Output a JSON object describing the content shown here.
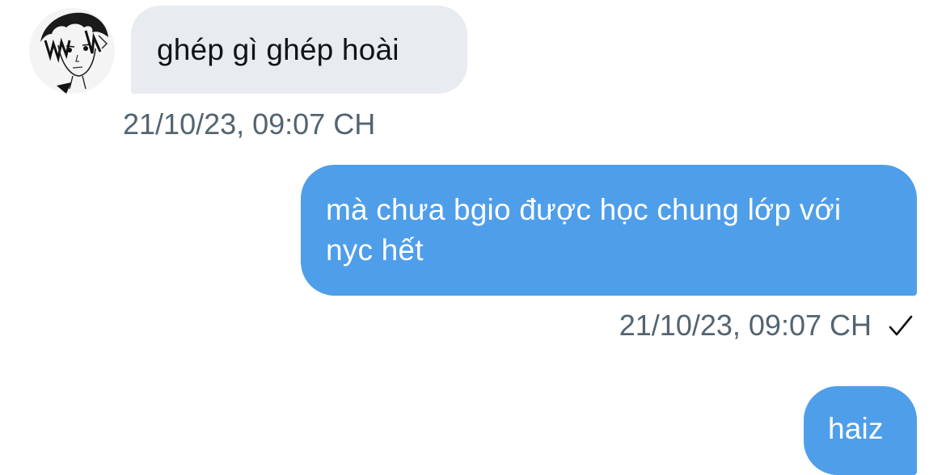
{
  "messages": [
    {
      "direction": "incoming",
      "text": "ghép gì ghép hoài",
      "timestamp": "21/10/23, 09:07 CH"
    },
    {
      "direction": "outgoing",
      "text": "mà chưa bgio được học chung lớp với nyc hết",
      "timestamp": "21/10/23, 09:07 CH",
      "status_icon": "checkmark-icon"
    },
    {
      "direction": "outgoing",
      "text": "haiz"
    }
  ],
  "avatar": {
    "icon": "manga-portrait-avatar"
  },
  "colors": {
    "incoming_bubble": "#e8ecf0",
    "outgoing_bubble": "#4f9ee9",
    "timestamp_text": "#536471",
    "incoming_text": "#0f1419",
    "outgoing_text": "#ffffff"
  }
}
